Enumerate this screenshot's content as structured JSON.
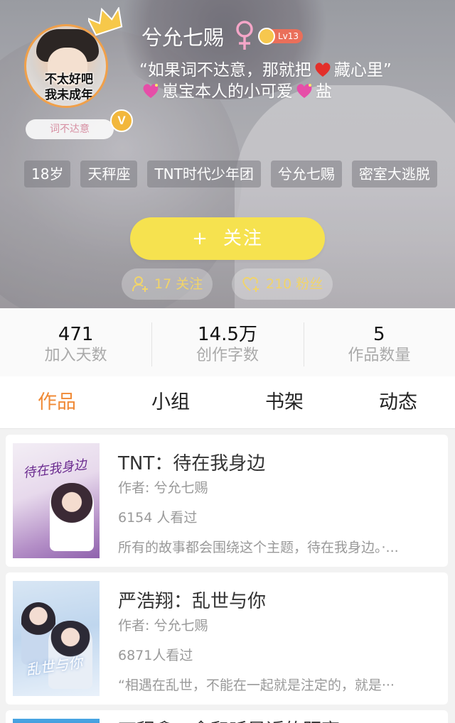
{
  "profile": {
    "nickname": "兮允七赐",
    "level": "Lv13",
    "avatar_text_line1": "不太好吧",
    "avatar_text_line2": "我未成年",
    "verified_mark": "V",
    "signature_pill": "词不达意",
    "bio_line1_a": "“如果词不达意，那就把",
    "bio_line1_b": "藏心里”",
    "bio_line2_a": "崽宝本人的小可爱",
    "bio_line2_b": "盐",
    "tags": [
      "18岁",
      "天秤座",
      "TNT时代少年团",
      "兮允七赐",
      "密室大逃脱"
    ],
    "follow_button_plus": "+",
    "follow_button_label": "关注",
    "following": "17 关注",
    "fans": "210 粉丝"
  },
  "stats": [
    {
      "value": "471",
      "label": "加入天数"
    },
    {
      "value": "14.5万",
      "label": "创作字数"
    },
    {
      "value": "5",
      "label": "作品数量"
    }
  ],
  "tabs": [
    {
      "label": "作品",
      "active": true
    },
    {
      "label": "小组",
      "active": false
    },
    {
      "label": "书架",
      "active": false
    },
    {
      "label": "动态",
      "active": false
    }
  ],
  "works": [
    {
      "title": "TNT：待在我身边",
      "author": "作者: 兮允七赐",
      "views": "6154 人看过",
      "description": "所有的故事都会围绕这个主题，待在我身边。·...",
      "cover_text": "待在我身边"
    },
    {
      "title": "严浩翔：乱世与你",
      "author": "作者: 兮允七赐",
      "views": "6871人看过",
      "description": "“相遇在乱世，不能在一起就是注定的，就是···",
      "cover_text": "乱世与你"
    },
    {
      "title": "丁程鑫：念和听是近的距离",
      "author": "",
      "views": "",
      "description": "",
      "cover_text": ""
    }
  ],
  "colors": {
    "accent_orange": "#f08a36",
    "follow_yellow": "#f6e24f",
    "gender_pink": "#f5a6c8",
    "level_red": "#ea6f5a"
  },
  "icons": {
    "crown": "crown-icon",
    "gender": "female-icon",
    "verified": "verified-icon",
    "heart": "red-heart-icon",
    "sparkle_heart": "sparkling-heart-icon",
    "following": "user-plus-icon",
    "fans": "heart-plus-icon"
  }
}
